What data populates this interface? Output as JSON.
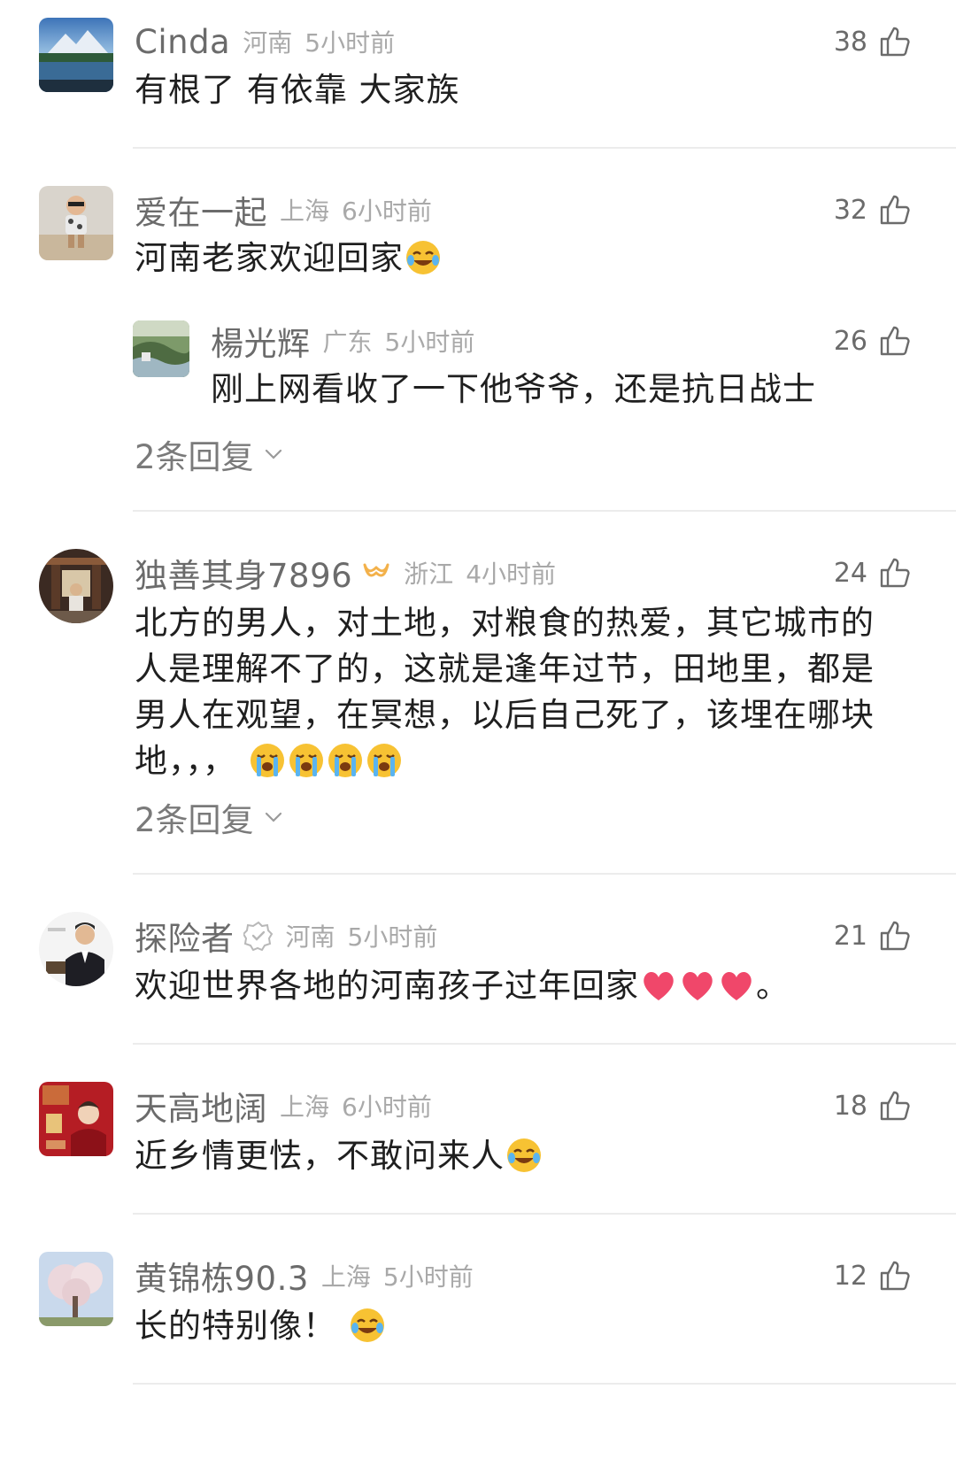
{
  "comments": [
    {
      "name": "Cinda",
      "location": "河南",
      "time": "5小时前",
      "likes": "38",
      "text": "有根了 有依靠 大家族",
      "avatar_icon": "lake-mountain-photo-avatar"
    },
    {
      "name": "爱在一起",
      "location": "上海",
      "time": "6小时前",
      "likes": "32",
      "text": "河南老家欢迎回家",
      "emoji": "tears-of-joy-emoji",
      "avatar_icon": "child-photo-avatar",
      "reply": {
        "name": "楊光辉",
        "location": "广东",
        "time": "5小时前",
        "likes": "26",
        "text": "刚上网看收了一下他爷爷，还是抗日战士",
        "avatar_icon": "river-landscape-avatar"
      },
      "replies_label": "2条回复"
    },
    {
      "name": "独善其身7896",
      "location": "浙江",
      "time": "4小时前",
      "likes": "24",
      "text_lines": [
        "北方的男人，对土地，对粮食的热爱，其它城市的",
        "人是理解不了的，这就是逢年过节，田地里，都是",
        "男人在观望，在冥想，以后自己死了，该埋在哪块",
        "地，，，"
      ],
      "emoji": "crying-face-emoji",
      "badge_icon": "vip-infinity-icon",
      "avatar_icon": "man-in-temple-avatar",
      "replies_label": "2条回复"
    },
    {
      "name": "探险者",
      "location": "河南",
      "time": "5小时前",
      "likes": "21",
      "text": "欢迎世界各地的河南孩子过年回家",
      "text_tail": "。",
      "emoji": "red-heart-emoji",
      "badge_icon": "verified-badge-icon",
      "avatar_icon": "man-in-suit-avatar"
    },
    {
      "name": "天高地阔",
      "location": "上海",
      "time": "6小时前",
      "likes": "18",
      "text": "近乡情更怯，不敢问来人",
      "emoji": "tears-of-joy-emoji",
      "avatar_icon": "red-poster-avatar"
    },
    {
      "name": "黄锦栋90.3",
      "location": "上海",
      "time": "5小时前",
      "likes": "12",
      "text": "长的特别像！",
      "emoji": "tears-of-joy-emoji",
      "avatar_icon": "cherry-blossom-avatar"
    }
  ],
  "colors": {
    "name": "#6b6b6b",
    "meta": "#a9a9a9",
    "text": "#1f1f1f",
    "divider": "#ececec",
    "vip": "#f3b14a"
  }
}
